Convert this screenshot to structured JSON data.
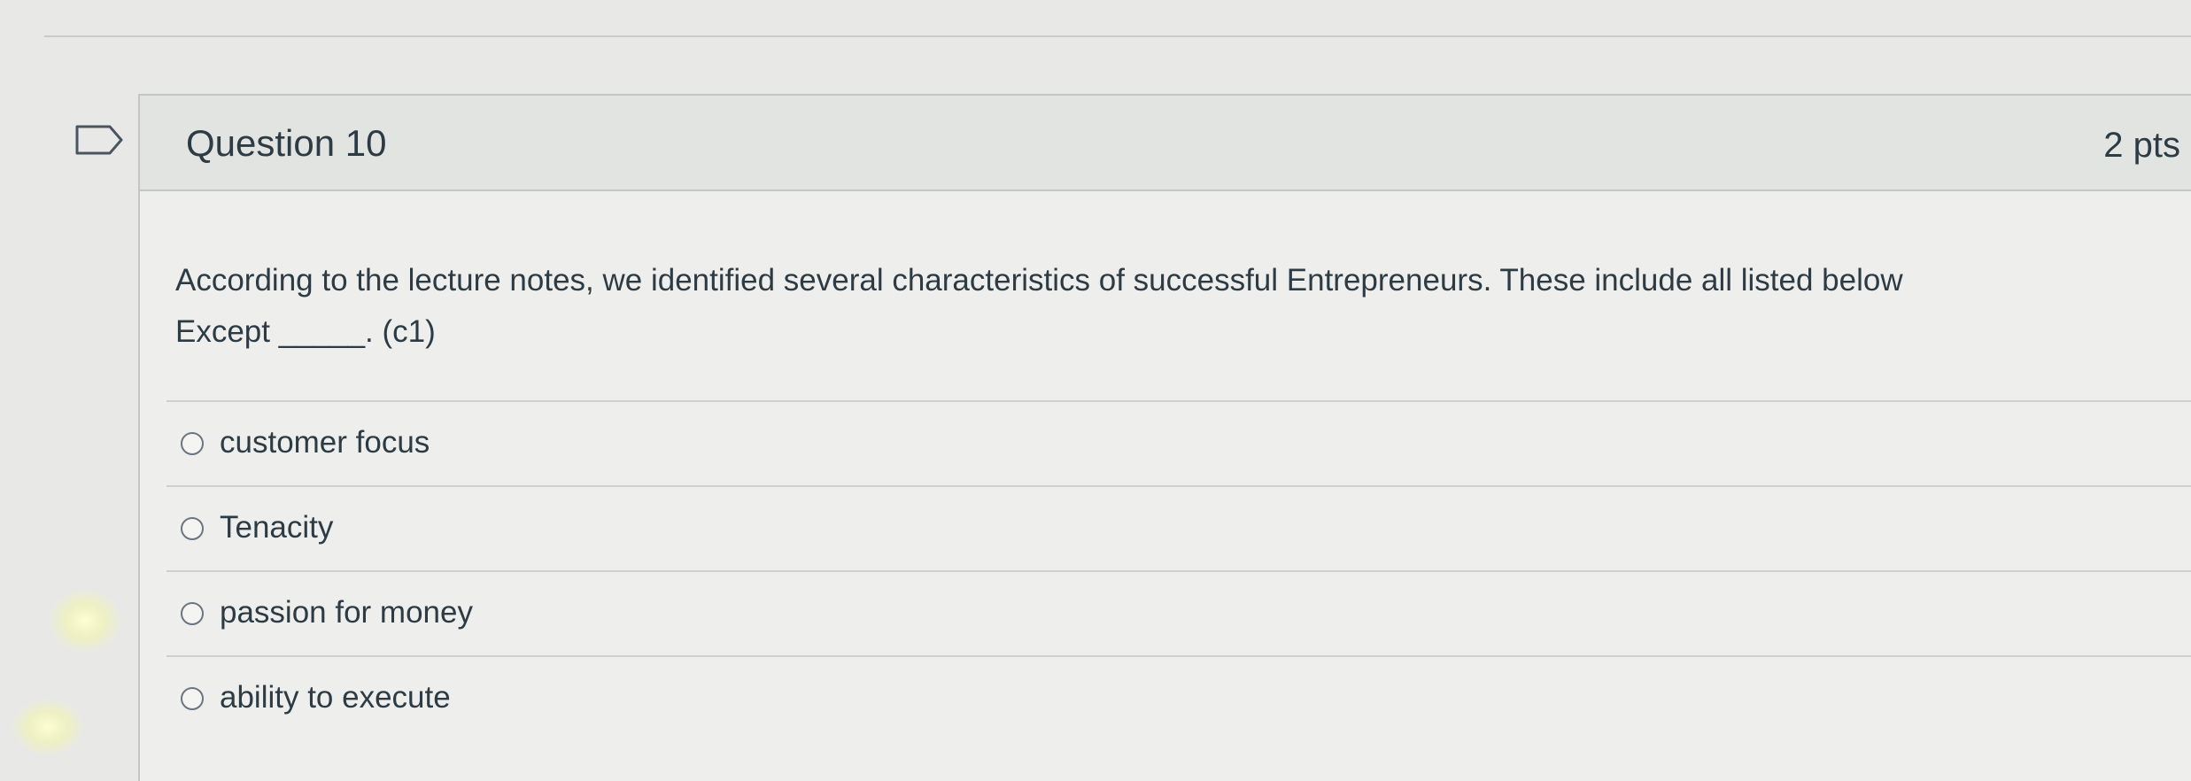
{
  "question": {
    "title": "Question 10",
    "points": "2 pts",
    "text_line_1": "According to the lecture notes, we identified several characteristics of successful Entrepreneurs. These include all listed below",
    "text_line_2": "Except _____. (c1)",
    "flag_icon": "flag-question-icon"
  },
  "answers": [
    {
      "label": "customer focus",
      "selected": false
    },
    {
      "label": "Tenacity",
      "selected": false
    },
    {
      "label": "passion for money",
      "selected": false
    },
    {
      "label": "ability to execute",
      "selected": false
    }
  ],
  "colors": {
    "page_background": "#e8e9e7",
    "header_background": "#e2e4e1",
    "text": "#2d3b45"
  }
}
